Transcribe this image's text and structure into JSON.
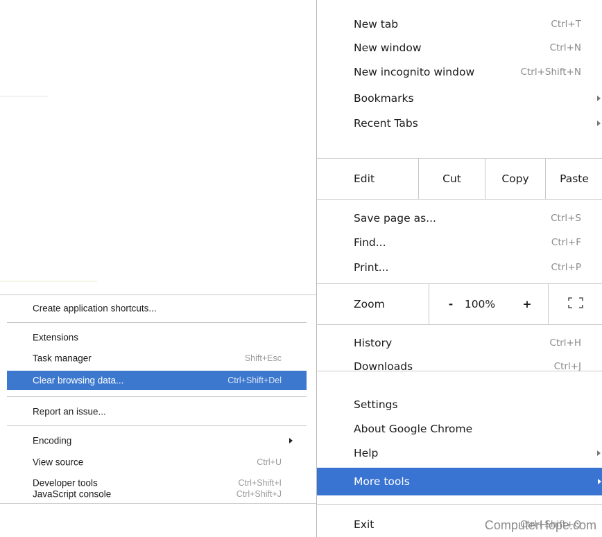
{
  "main_menu": {
    "items_top": [
      {
        "label": "New tab",
        "shortcut": "Ctrl+T"
      },
      {
        "label": "New window",
        "shortcut": "Ctrl+N"
      },
      {
        "label": "New incognito window",
        "shortcut": "Ctrl+Shift+N"
      },
      {
        "label": "Bookmarks",
        "has_submenu": true
      },
      {
        "label": "Recent Tabs",
        "has_submenu": true
      }
    ],
    "edit_row": {
      "label": "Edit",
      "cut": "Cut",
      "copy": "Copy",
      "paste": "Paste"
    },
    "items_page": [
      {
        "label": "Save page as...",
        "shortcut": "Ctrl+S"
      },
      {
        "label": "Find...",
        "shortcut": "Ctrl+F"
      },
      {
        "label": "Print...",
        "shortcut": "Ctrl+P"
      }
    ],
    "zoom_row": {
      "label": "Zoom",
      "minus": "-",
      "value": "100%",
      "plus": "+",
      "fullscreen_icon": "fullscreen-icon"
    },
    "items_history": [
      {
        "label": "History",
        "shortcut": "Ctrl+H"
      },
      {
        "label": "Downloads",
        "shortcut": "Ctrl+J"
      }
    ],
    "items_settings": [
      {
        "label": "Settings"
      },
      {
        "label": "About Google Chrome"
      },
      {
        "label": "Help",
        "has_submenu": true
      }
    ],
    "more_tools": {
      "label": "More tools",
      "has_submenu": true,
      "highlighted": true
    },
    "exit": {
      "label": "Exit",
      "shortcut": "Ctrl+Shift+Q"
    }
  },
  "sub_menu": {
    "create_shortcuts": {
      "label": "Create application shortcuts..."
    },
    "extensions": {
      "label": "Extensions"
    },
    "task_manager": {
      "label": "Task manager",
      "shortcut": "Shift+Esc"
    },
    "clear_browsing": {
      "label": "Clear browsing data...",
      "shortcut": "Ctrl+Shift+Del",
      "highlighted": true
    },
    "report_issue": {
      "label": "Report an issue..."
    },
    "encoding": {
      "label": "Encoding",
      "has_submenu": true
    },
    "view_source": {
      "label": "View source",
      "shortcut": "Ctrl+U"
    },
    "developer_tools": {
      "label": "Developer tools",
      "shortcut": "Ctrl+Shift+I"
    },
    "js_console": {
      "label": "JavaScript console",
      "shortcut": "Ctrl+Shift+J"
    }
  },
  "watermark": "ComputerHope.com",
  "colors": {
    "highlight": "#3a74d3",
    "separator": "#c8c8c8",
    "shortcut_text": "#8a8a8a"
  }
}
